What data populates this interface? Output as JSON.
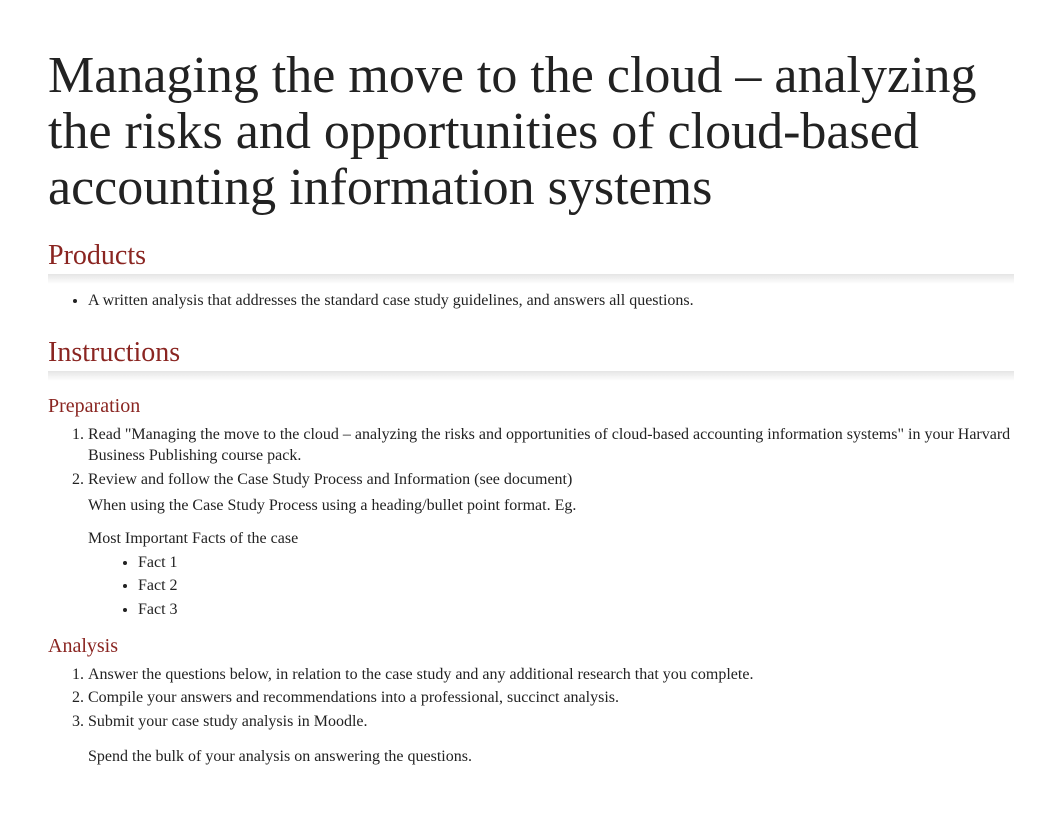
{
  "title": "Managing the move to the cloud – analyzing the risks and opportunities of cloud-based accounting information systems",
  "sections": {
    "products": {
      "heading": "Products",
      "items": [
        "A written analysis that addresses the standard case study guidelines, and answers all questions."
      ]
    },
    "instructions": {
      "heading": "Instructions",
      "preparation": {
        "heading": "Preparation",
        "steps": [
          "Read \"Managing the move to the cloud – analyzing the risks and opportunities of cloud-based accounting information systems\" in your Harvard Business Publishing course pack.",
          "Review and follow the Case Study Process and Information (see document)"
        ],
        "step2_extra": "When using the Case Study Process using a heading/bullet point format.  Eg.",
        "facts_heading": "Most Important Facts of the case",
        "facts": [
          "Fact 1",
          "Fact 2",
          "Fact 3"
        ]
      },
      "analysis": {
        "heading": "Analysis",
        "steps": [
          "Answer the questions below, in relation to the case study and any additional research that you complete.",
          "Compile your answers and recommendations into a professional, succinct analysis.",
          "Submit your case study analysis in Moodle."
        ],
        "final_note": "Spend the bulk of your analysis on answering the questions."
      }
    }
  }
}
